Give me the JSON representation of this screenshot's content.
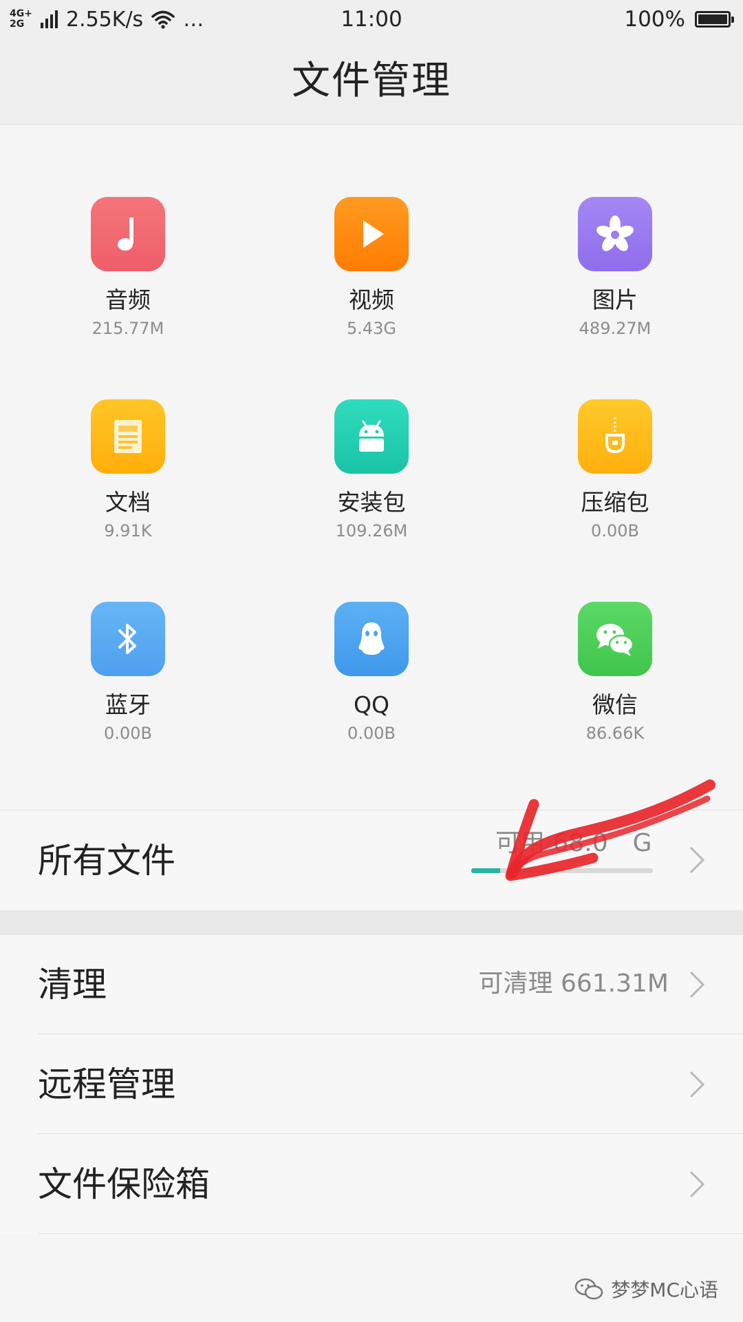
{
  "status_bar": {
    "network_top": "4G+",
    "network_bottom": "2G",
    "speed": "2.55K/s",
    "time": "11:00",
    "battery": "100%",
    "more": "…"
  },
  "title": "文件管理",
  "categories": [
    {
      "name": "音频",
      "size": "215.77M",
      "icon": "music-note-icon",
      "color": "#f06b72"
    },
    {
      "name": "视频",
      "size": "5.43G",
      "icon": "play-icon",
      "color": "#ff8c0f"
    },
    {
      "name": "图片",
      "size": "489.27M",
      "icon": "flower-icon",
      "color": "#9b7cf0"
    },
    {
      "name": "文档",
      "size": "9.91K",
      "icon": "document-icon",
      "color": "#ffba1a"
    },
    {
      "name": "安装包",
      "size": "109.26M",
      "icon": "android-icon",
      "color": "#22d0b2"
    },
    {
      "name": "压缩包",
      "size": "0.00B",
      "icon": "zip-icon",
      "color": "#ffbe1c"
    },
    {
      "name": "蓝牙",
      "size": "0.00B",
      "icon": "bluetooth-icon",
      "color": "#5aaaf3"
    },
    {
      "name": "QQ",
      "size": "0.00B",
      "icon": "qq-penguin-icon",
      "color": "#4ea6f0"
    },
    {
      "name": "微信",
      "size": "86.66K",
      "icon": "wechat-icon",
      "color": "#4fd15b"
    }
  ],
  "all_files": {
    "label": "所有文件",
    "available": "可用 68.0",
    "available_tail": "G",
    "used_fraction": 0.16
  },
  "list": [
    {
      "label": "清理",
      "value": "可清理 661.31M"
    },
    {
      "label": "远程管理",
      "value": ""
    },
    {
      "label": "文件保险箱",
      "value": ""
    }
  ],
  "watermark": "梦梦MC心语",
  "colors": {
    "accent": "#26b5a3",
    "annotation": "#e8262b"
  }
}
